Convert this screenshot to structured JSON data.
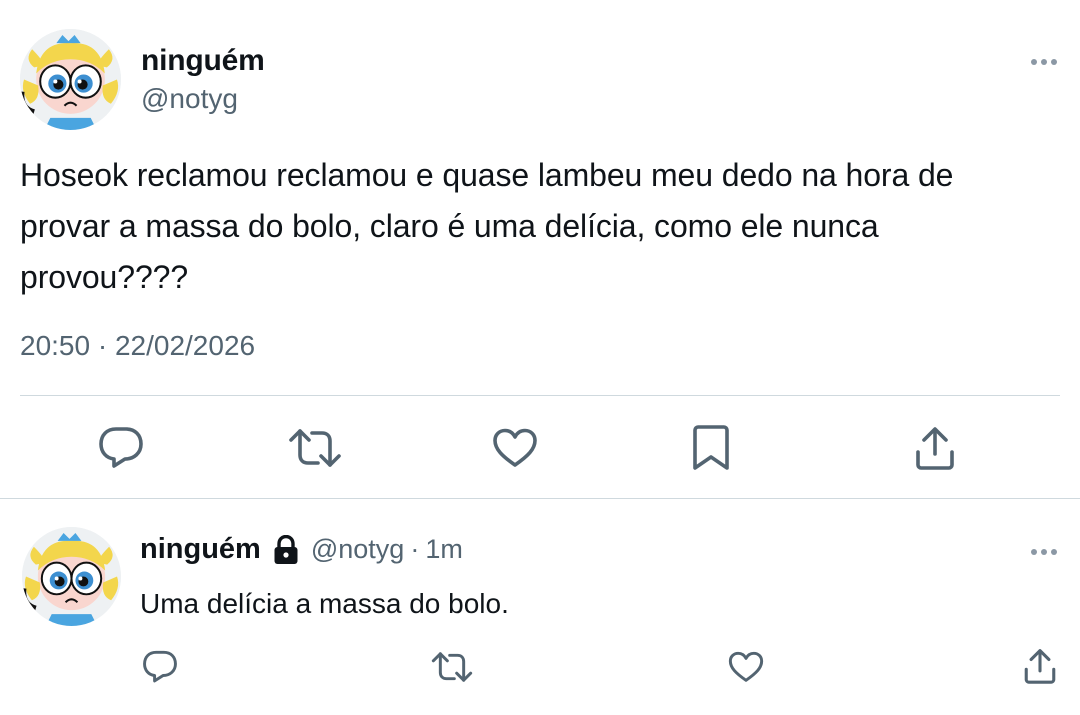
{
  "main_tweet": {
    "name": "ninguém",
    "handle": "@notyg",
    "text": "Hoseok reclamou reclamou e quase lambeu meu dedo na hora de provar a massa do bolo, claro é uma delícia, como ele nunca provou????",
    "timestamp": "20:50 · 22/02/2026",
    "avatar_icon": "powerpuff-bubbles-avatar",
    "actions": [
      "reply-icon",
      "retweet-icon",
      "like-icon",
      "bookmark-icon",
      "share-icon"
    ]
  },
  "reply_tweet": {
    "name": "ninguém",
    "handle": "@notyg",
    "separator": "·",
    "time": "1m",
    "text": "Uma delícia a massa do bolo.",
    "locked": true,
    "avatar_icon": "powerpuff-bubbles-avatar",
    "actions": [
      "reply-icon",
      "retweet-icon",
      "like-icon",
      "share-icon"
    ]
  },
  "colors": {
    "text": "#0f1419",
    "secondary": "#536471",
    "divider": "#cfd9de"
  }
}
